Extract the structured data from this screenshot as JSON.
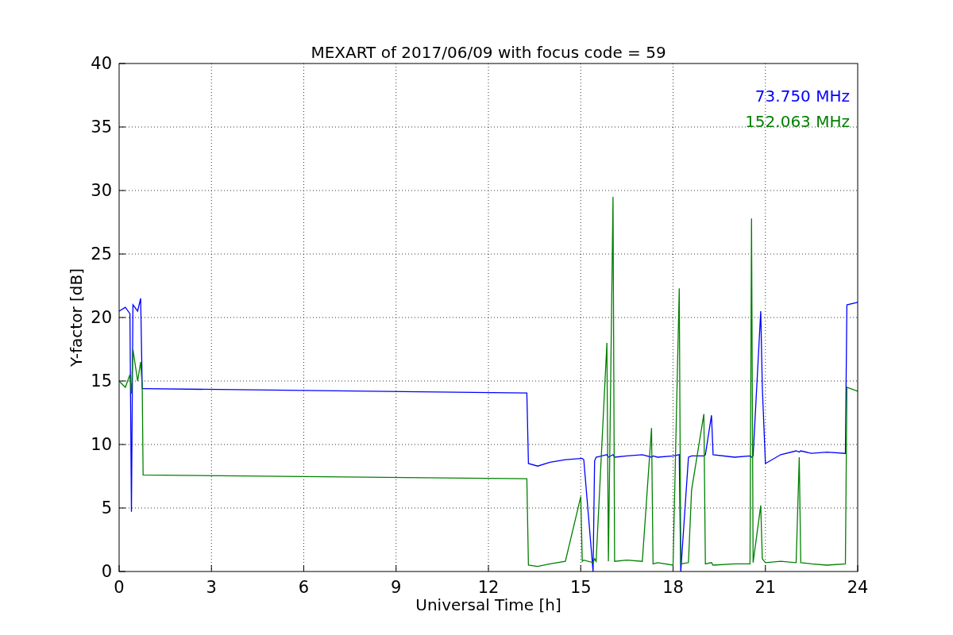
{
  "figure": {
    "chart_data": {
      "type": "line",
      "title": "MEXART of 2017/06/09 with focus code = 59",
      "xlabel": "Universal Time [h]",
      "ylabel": "Y-factor [dB]",
      "x": [
        0,
        0.2,
        0.35,
        0.4,
        0.45,
        0.6,
        0.7,
        0.75,
        0.78,
        13.25,
        13.3,
        13.6,
        14,
        14.5,
        15,
        15.05,
        15.1,
        15.4,
        15.45,
        15.5,
        15.85,
        15.9,
        16.05,
        16.1,
        16.5,
        17,
        17.3,
        17.35,
        17.5,
        18,
        18.2,
        18.25,
        18.5,
        18.6,
        19,
        19.05,
        19.25,
        19.3,
        20,
        20.5,
        20.55,
        20.6,
        20.85,
        20.9,
        21,
        21.5,
        22,
        22.1,
        22.15,
        22.5,
        23,
        23.6,
        23.65,
        24
      ],
      "series": [
        {
          "name": "73.750 MHz",
          "color": "#0000ff",
          "values": [
            20.5,
            20.8,
            20.3,
            4.7,
            21,
            20.5,
            21.5,
            14.4,
            14.4,
            14.05,
            8.5,
            8.3,
            8.6,
            8.8,
            8.9,
            8.9,
            8.8,
            0,
            8.7,
            9,
            9.2,
            9,
            9.2,
            9,
            9.1,
            9.2,
            9,
            9.1,
            9,
            9.1,
            9.2,
            0,
            9,
            9.1,
            9.1,
            9.2,
            12.3,
            9.2,
            9,
            9.1,
            9,
            9.1,
            20.5,
            14.5,
            8.5,
            9.2,
            9.5,
            9.4,
            9.5,
            9.3,
            9.4,
            9.3,
            21,
            21.2
          ]
        },
        {
          "name": "152.063 MHz",
          "color": "#008000",
          "values": [
            15,
            14.5,
            15.5,
            14,
            17.5,
            15,
            16.5,
            14.5,
            7.6,
            7.3,
            0.5,
            0.4,
            0.6,
            0.8,
            5.9,
            0.8,
            0.9,
            0.7,
            1,
            0.8,
            18,
            0.8,
            29.5,
            0.8,
            0.9,
            0.8,
            11.3,
            0.6,
            0.7,
            0.5,
            22.3,
            0.6,
            0.7,
            6.4,
            12.4,
            0.6,
            0.7,
            0.5,
            0.6,
            0.6,
            27.8,
            0.7,
            5.2,
            1,
            0.7,
            0.8,
            0.7,
            9,
            0.7,
            0.6,
            0.5,
            0.6,
            14.5,
            14.2
          ]
        }
      ],
      "grid": true,
      "xlim": [
        0,
        24
      ],
      "ylim": [
        0,
        40
      ],
      "xticks": [
        0,
        3,
        6,
        9,
        12,
        15,
        18,
        21,
        24
      ],
      "yticks": [
        0,
        5,
        10,
        15,
        20,
        25,
        30,
        35,
        40
      ]
    }
  }
}
